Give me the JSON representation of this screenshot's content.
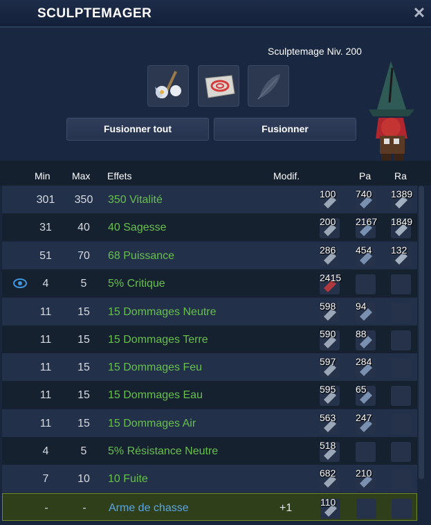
{
  "window": {
    "title": "SCULPTEMAGER",
    "close_glyph": "✕"
  },
  "header": {
    "level_text": "Sculptemage Niv. 200",
    "slot_count": "2"
  },
  "buttons": {
    "merge_all": "Fusionner tout",
    "merge": "Fusionner"
  },
  "columns": {
    "min": "Min",
    "max": "Max",
    "effects": "Effets",
    "modif": "Modif.",
    "pa": "Pa",
    "ra": "Ra"
  },
  "rows": [
    {
      "min": "301",
      "max": "350",
      "effect": "350 Vitalité",
      "modif": "",
      "ba": "100",
      "pa": "740",
      "ra": "1389"
    },
    {
      "min": "31",
      "max": "40",
      "effect": "40 Sagesse",
      "modif": "",
      "ba": "200",
      "pa": "2167",
      "ra": "1849"
    },
    {
      "min": "51",
      "max": "70",
      "effect": "68 Puissance",
      "modif": "",
      "ba": "286",
      "pa": "454",
      "ra": "132"
    },
    {
      "min": "4",
      "max": "5",
      "effect": "5% Critique",
      "modif": "",
      "ba": "2415",
      "pa": "",
      "ra": ""
    },
    {
      "min": "11",
      "max": "15",
      "effect": "15 Dommages Neutre",
      "modif": "",
      "ba": "598",
      "pa": "94",
      "ra": ""
    },
    {
      "min": "11",
      "max": "15",
      "effect": "15 Dommages Terre",
      "modif": "",
      "ba": "590",
      "pa": "88",
      "ra": ""
    },
    {
      "min": "11",
      "max": "15",
      "effect": "15 Dommages Feu",
      "modif": "",
      "ba": "597",
      "pa": "284",
      "ra": ""
    },
    {
      "min": "11",
      "max": "15",
      "effect": "15 Dommages Eau",
      "modif": "",
      "ba": "595",
      "pa": "65",
      "ra": ""
    },
    {
      "min": "11",
      "max": "15",
      "effect": "15 Dommages Air",
      "modif": "",
      "ba": "563",
      "pa": "247",
      "ra": ""
    },
    {
      "min": "4",
      "max": "5",
      "effect": "5% Résistance Neutre",
      "modif": "",
      "ba": "518",
      "pa": "",
      "ra": ""
    },
    {
      "min": "7",
      "max": "10",
      "effect": "10 Fuite",
      "modif": "",
      "ba": "682",
      "pa": "210",
      "ra": ""
    },
    {
      "min": "-",
      "max": "-",
      "effect": "Arme de chasse",
      "modif": "+1",
      "ba": "110",
      "pa": "",
      "ra": ""
    }
  ],
  "icons": {
    "slot1": "weapon-icon",
    "slot2": "rune-stone-icon",
    "slot3": "feather-icon",
    "eye": "eye-icon",
    "close": "close-icon",
    "character": "wizard-avatar"
  },
  "colors": {
    "effect_green": "#67c04c",
    "hunt_blue": "#5aa5e8",
    "hunt_bg": "#2e3f1a"
  }
}
